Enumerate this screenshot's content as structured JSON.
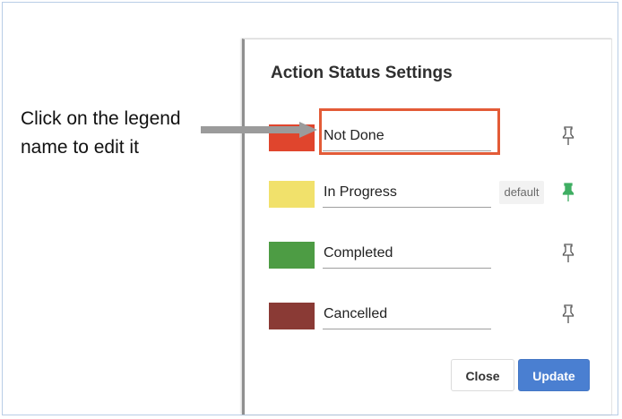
{
  "annotation": {
    "line1": "Click on the legend",
    "line2": "name to edit it"
  },
  "dialog": {
    "title": "Action Status Settings",
    "default_label": "default",
    "statuses": [
      {
        "name": "Not Done",
        "color": "#e0452d",
        "pin_color": "#555555",
        "highlighted": true
      },
      {
        "name": "In Progress",
        "color": "#f1e16b",
        "pin_color": "#3fae62",
        "is_default": true
      },
      {
        "name": "Completed",
        "color": "#4d9c44",
        "pin_color": "#555555"
      },
      {
        "name": "Cancelled",
        "color": "#8a3a35",
        "pin_color": "#555555"
      }
    ],
    "buttons": {
      "close": "Close",
      "update": "Update"
    }
  },
  "colors": {
    "highlight": "#e35b37",
    "arrow": "#9b9b9b",
    "update_button": "#4a7fd1"
  },
  "icons": {
    "pin": "pushpin-icon"
  }
}
